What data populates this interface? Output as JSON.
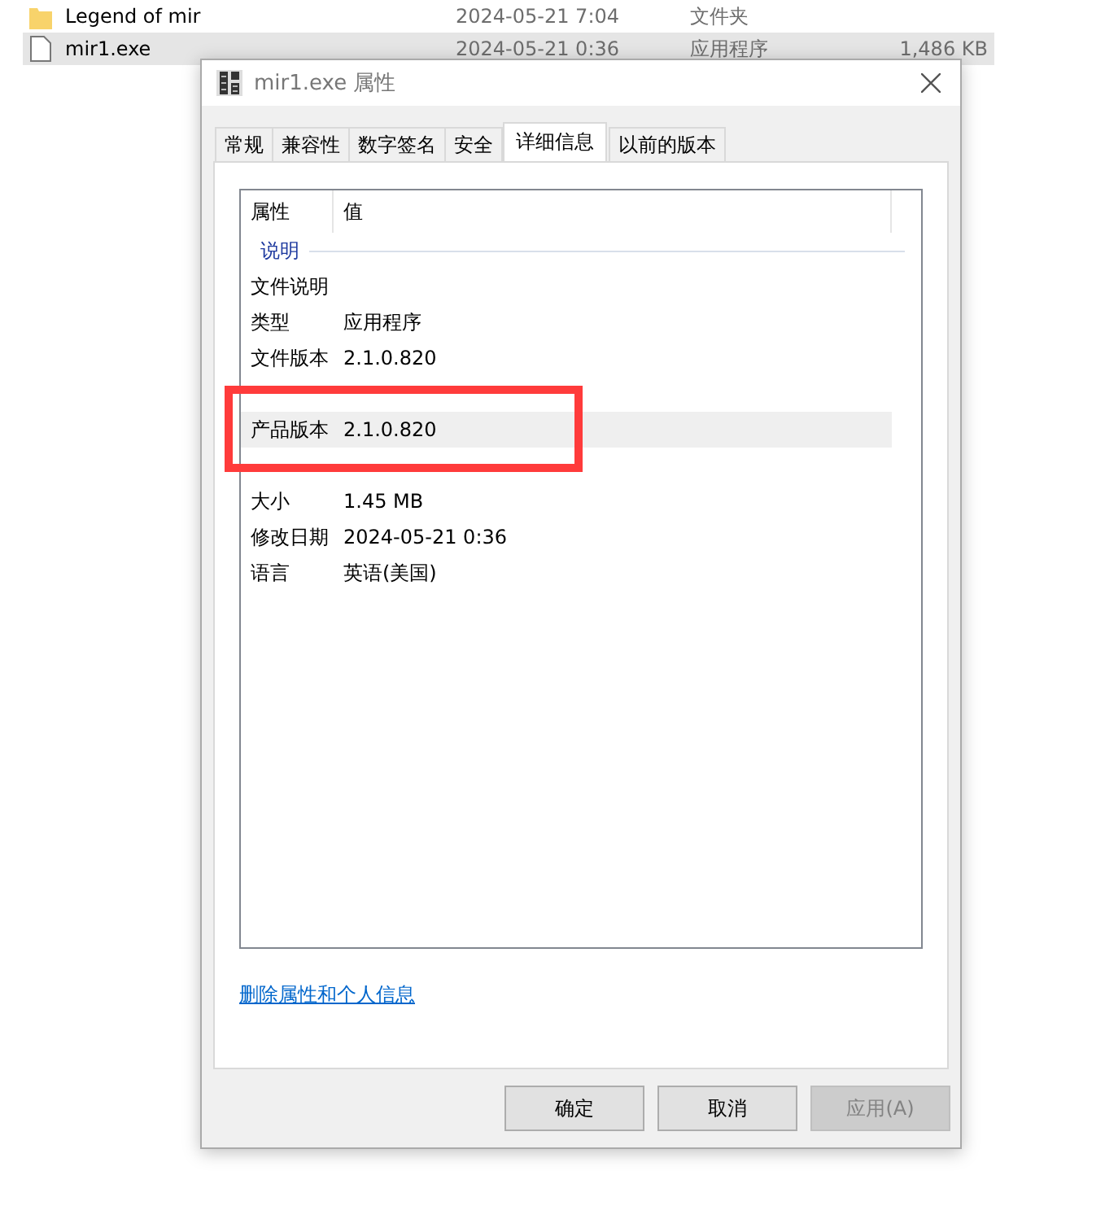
{
  "files": [
    {
      "kind": "folder",
      "name": "Legend of mir",
      "date": "2024-05-21 7:04",
      "type": "文件夹",
      "selected": false
    },
    {
      "kind": "file",
      "name": "mir1.exe",
      "date": "2024-05-21 0:36",
      "type": "应用程序",
      "size": "1,486 KB",
      "selected": true
    }
  ],
  "dialog": {
    "title": "mir1.exe 属性",
    "tabs": [
      {
        "label": "常规",
        "selected": false
      },
      {
        "label": "兼容性",
        "selected": false
      },
      {
        "label": "数字签名",
        "selected": false
      },
      {
        "label": "安全",
        "selected": false
      },
      {
        "label": "详细信息",
        "selected": true
      },
      {
        "label": "以前的版本",
        "selected": false
      }
    ],
    "columns": [
      "属性",
      "值"
    ],
    "group": "说明",
    "rows": [
      {
        "name": "文件说明",
        "selected": false
      },
      {
        "name": "类型",
        "value": "应用程序",
        "selected": false
      },
      {
        "name": "文件版本",
        "value": "2.1.0.820",
        "selected": false
      },
      {
        "kind": "covered"
      },
      {
        "name": "产品版本",
        "value": "2.1.0.820",
        "selected": true
      },
      {
        "kind": "covered"
      },
      {
        "name": "大小",
        "value": "1.45 MB",
        "selected": false
      },
      {
        "name": "修改日期",
        "value": "2024-05-21 0:36",
        "selected": false
      },
      {
        "name": "语言",
        "value": "英语(美国)",
        "selected": false
      }
    ],
    "link": "删除属性和个人信息",
    "buttons": [
      {
        "label": "确定",
        "disabled": false
      },
      {
        "label": "取消",
        "disabled": false
      },
      {
        "label": "应用(A)",
        "disabled": true
      }
    ]
  }
}
